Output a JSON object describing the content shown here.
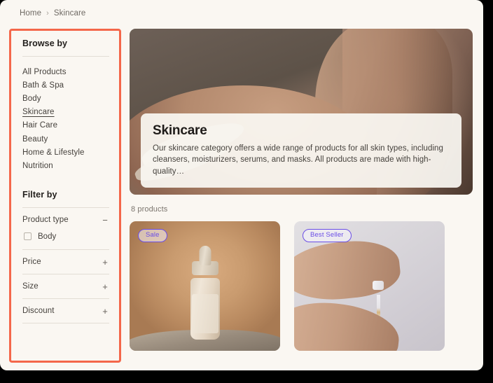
{
  "breadcrumb": {
    "items": [
      {
        "label": "Home"
      },
      {
        "label": "Skincare"
      }
    ],
    "separator": "›"
  },
  "sidebar": {
    "browse": {
      "title": "Browse by",
      "items": [
        {
          "label": "All Products",
          "active": false
        },
        {
          "label": "Bath & Spa",
          "active": false
        },
        {
          "label": "Body",
          "active": false
        },
        {
          "label": "Skincare",
          "active": true
        },
        {
          "label": "Hair Care",
          "active": false
        },
        {
          "label": "Beauty",
          "active": false
        },
        {
          "label": "Home & Lifestyle",
          "active": false
        },
        {
          "label": "Nutrition",
          "active": false
        }
      ]
    },
    "filter": {
      "title": "Filter by",
      "groups": [
        {
          "label": "Product type",
          "sign": "−"
        },
        {
          "label": "Price",
          "sign": "+"
        },
        {
          "label": "Size",
          "sign": "+"
        },
        {
          "label": "Discount",
          "sign": "+"
        }
      ],
      "product_type_options": [
        {
          "label": "Body",
          "checked": false
        }
      ]
    },
    "highlight_color": "#f4674a"
  },
  "hero": {
    "title": "Skincare",
    "description": "Our skincare category offers a wide range of products for all skin types, including cleansers, moisturizers, serums, and masks. All products are made with high-quality…"
  },
  "main": {
    "product_count": "8 products",
    "products": [
      {
        "badge": "Sale",
        "media": "serum-bottle-on-stone"
      },
      {
        "badge": "Best Seller",
        "media": "hands-with-dropper"
      }
    ],
    "badge_color": "#6a4de6"
  },
  "colors": {
    "page_background": "#faf7f2",
    "text_primary": "#23201d",
    "text_secondary": "#6f6a64",
    "divider": "#e2ddd5"
  }
}
